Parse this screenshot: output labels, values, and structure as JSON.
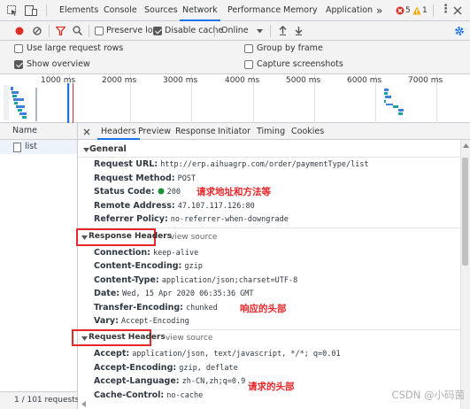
{
  "tabbar": {
    "tabs": [
      "Elements",
      "Console",
      "Sources",
      "Network",
      "Performance",
      "Memory",
      "Application"
    ],
    "more": "»",
    "error_count": "5",
    "warning_count": "1"
  },
  "toolbar": {
    "preserve_log": "Preserve log",
    "disable_cache": "Disable cache",
    "throttle": "Online"
  },
  "settings": {
    "large_rows": "Use large request rows",
    "show_overview": "Show overview",
    "group_by_frame": "Group by frame",
    "capture_screenshots": "Capture screenshots"
  },
  "overview": {
    "ticks": [
      "1000 ms",
      "2000 ms",
      "3000 ms",
      "4000 ms",
      "5000 ms",
      "6000 ms",
      "7000 ms"
    ]
  },
  "left": {
    "name_header": "Name",
    "items": [
      "list"
    ],
    "footer": "1 / 101 requests"
  },
  "details": {
    "tabs": [
      "Headers",
      "Preview",
      "Response",
      "Initiator",
      "Timing",
      "Cookies"
    ],
    "general": {
      "title": "General",
      "rows": [
        {
          "k": "Request URL:",
          "v": "http://erp.aihuagrp.com/order/paymentType/list"
        },
        {
          "k": "Request Method:",
          "v": "POST"
        },
        {
          "k": "Status Code:",
          "v": "200"
        },
        {
          "k": "Remote Address:",
          "v": "47.107.117.126:80"
        },
        {
          "k": "Referrer Policy:",
          "v": "no-referrer-when-downgrade"
        }
      ]
    },
    "response_headers": {
      "title": "Response Headers",
      "view_source": "view source",
      "rows": [
        {
          "k": "Connection:",
          "v": "keep-alive"
        },
        {
          "k": "Content-Encoding:",
          "v": "gzip"
        },
        {
          "k": "Content-Type:",
          "v": "application/json;charset=UTF-8"
        },
        {
          "k": "Date:",
          "v": "Wed, 15 Apr 2020 06:35:36 GMT"
        },
        {
          "k": "Transfer-Encoding:",
          "v": "chunked"
        },
        {
          "k": "Vary:",
          "v": "Accept-Encoding"
        }
      ]
    },
    "request_headers": {
      "title": "Request Headers",
      "view_source": "view source",
      "rows": [
        {
          "k": "Accept:",
          "v": "application/json, text/javascript, */*; q=0.01"
        },
        {
          "k": "Accept-Encoding:",
          "v": "gzip, deflate"
        },
        {
          "k": "Accept-Language:",
          "v": "zh-CN,zh;q=0.9"
        },
        {
          "k": "Cache-Control:",
          "v": "no-cache"
        }
      ]
    },
    "annotations": [
      "请求地址和方法等",
      "响应的头部",
      "请求的头部"
    ]
  },
  "watermark": "CSDN @小码菌",
  "colors": {
    "accent": "#1a73e8",
    "annotation_red": "#e5262a",
    "status_green": "#1e8e3e",
    "error_red": "#d93025",
    "warning_yellow": "#f2a600"
  }
}
